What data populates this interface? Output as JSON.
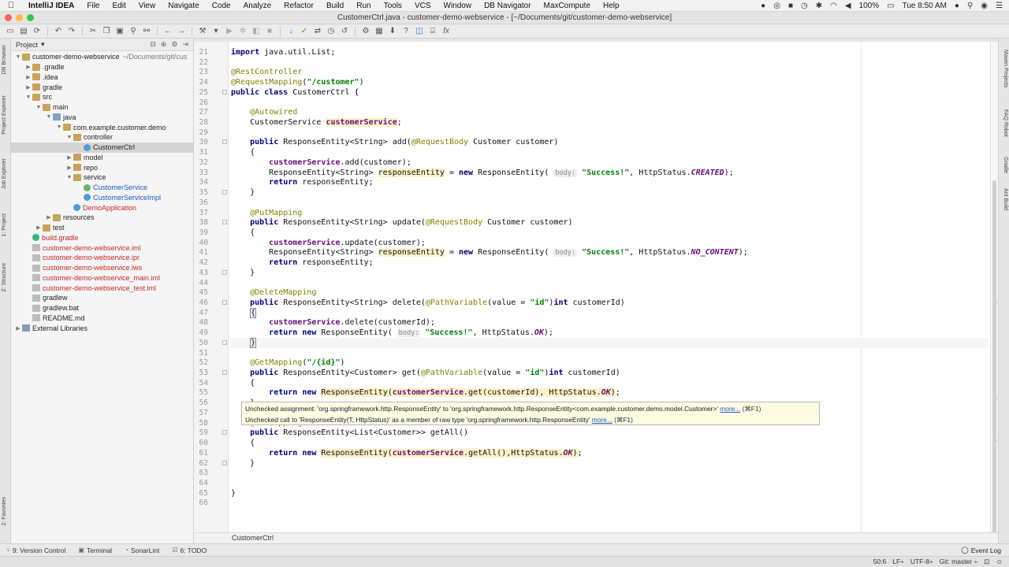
{
  "menubar": {
    "app_name": "IntelliJ IDEA",
    "items": [
      "File",
      "Edit",
      "View",
      "Navigate",
      "Code",
      "Analyze",
      "Refactor",
      "Build",
      "Run",
      "Tools",
      "VCS",
      "Window",
      "DB Navigator",
      "MaxCompute",
      "Help"
    ],
    "battery": "100%",
    "clock": "Tue 8:50 AM"
  },
  "window": {
    "title": "CustomerCtrl.java - customer-demo-webservice - [~/Documents/git/customer-demo-webservice]"
  },
  "side_tabs": {
    "left": [
      "DB Browser",
      "Project Explorer",
      "Job Explorer",
      "1: Project",
      "Z: Structure",
      "2: Favorites"
    ],
    "right": [
      "Maven Projects",
      "FAQ Robot",
      "Gradle",
      "Ant Build"
    ]
  },
  "project": {
    "header": "Project",
    "tree": [
      {
        "label": "customer-demo-webservice",
        "suffix": "~/Documents/git/cus",
        "indent": 0,
        "arrow": "▼",
        "icon": "folder",
        "color": ""
      },
      {
        "label": ".gradle",
        "suffix": "",
        "indent": 1,
        "arrow": "▶",
        "icon": "folder",
        "color": ""
      },
      {
        "label": ".idea",
        "suffix": "",
        "indent": 1,
        "arrow": "▶",
        "icon": "folder",
        "color": ""
      },
      {
        "label": "gradle",
        "suffix": "",
        "indent": 1,
        "arrow": "▶",
        "icon": "folder",
        "color": ""
      },
      {
        "label": "src",
        "suffix": "",
        "indent": 1,
        "arrow": "▼",
        "icon": "folder",
        "color": ""
      },
      {
        "label": "main",
        "suffix": "",
        "indent": 2,
        "arrow": "▼",
        "icon": "folder",
        "color": ""
      },
      {
        "label": "java",
        "suffix": "",
        "indent": 3,
        "arrow": "▼",
        "icon": "srcfolder",
        "color": ""
      },
      {
        "label": "com.example.customer.demo",
        "suffix": "",
        "indent": 4,
        "arrow": "▼",
        "icon": "folder",
        "color": ""
      },
      {
        "label": "controller",
        "suffix": "",
        "indent": 5,
        "arrow": "▼",
        "icon": "folder",
        "color": ""
      },
      {
        "label": "CustomerCtrl",
        "suffix": "",
        "indent": 6,
        "arrow": "",
        "icon": "cls",
        "color": "",
        "selected": true
      },
      {
        "label": "model",
        "suffix": "",
        "indent": 5,
        "arrow": "▶",
        "icon": "folder",
        "color": ""
      },
      {
        "label": "repo",
        "suffix": "",
        "indent": 5,
        "arrow": "▶",
        "icon": "folder",
        "color": ""
      },
      {
        "label": "service",
        "suffix": "",
        "indent": 5,
        "arrow": "▼",
        "icon": "folder",
        "color": ""
      },
      {
        "label": "CustomerService",
        "suffix": "",
        "indent": 6,
        "arrow": "",
        "icon": "intf",
        "color": "blue"
      },
      {
        "label": "CustomerServiceImpl",
        "suffix": "",
        "indent": 6,
        "arrow": "",
        "icon": "cls",
        "color": "blue"
      },
      {
        "label": "DemoApplication",
        "suffix": "",
        "indent": 5,
        "arrow": "",
        "icon": "cls",
        "color": "red"
      },
      {
        "label": "resources",
        "suffix": "",
        "indent": 3,
        "arrow": "▶",
        "icon": "folder",
        "color": ""
      },
      {
        "label": "test",
        "suffix": "",
        "indent": 2,
        "arrow": "▶",
        "icon": "folder",
        "color": ""
      },
      {
        "label": "build.gradle",
        "suffix": "",
        "indent": 1,
        "arrow": "",
        "icon": "gradle",
        "color": "red"
      },
      {
        "label": "customer-demo-webservice.iml",
        "suffix": "",
        "indent": 1,
        "arrow": "",
        "icon": "file",
        "color": "red"
      },
      {
        "label": "customer-demo-webservice.ipr",
        "suffix": "",
        "indent": 1,
        "arrow": "",
        "icon": "file",
        "color": "red"
      },
      {
        "label": "customer-demo-webservice.iws",
        "suffix": "",
        "indent": 1,
        "arrow": "",
        "icon": "file",
        "color": "red"
      },
      {
        "label": "customer-demo-webservice_main.iml",
        "suffix": "",
        "indent": 1,
        "arrow": "",
        "icon": "file",
        "color": "red"
      },
      {
        "label": "customer-demo-webservice_test.iml",
        "suffix": "",
        "indent": 1,
        "arrow": "",
        "icon": "file",
        "color": "red"
      },
      {
        "label": "gradlew",
        "suffix": "",
        "indent": 1,
        "arrow": "",
        "icon": "file",
        "color": ""
      },
      {
        "label": "gradlew.bat",
        "suffix": "",
        "indent": 1,
        "arrow": "",
        "icon": "file",
        "color": ""
      },
      {
        "label": "README.md",
        "suffix": "",
        "indent": 1,
        "arrow": "",
        "icon": "file",
        "color": ""
      },
      {
        "label": "External Libraries",
        "suffix": "",
        "indent": 0,
        "arrow": "▶",
        "icon": "lib",
        "color": ""
      }
    ]
  },
  "editor": {
    "first_line": 21,
    "lines": [
      "<span class=\"kw\">import</span> java.util.List;",
      "",
      "<span class=\"ann\">@RestController</span>",
      "<span class=\"ann\">@RequestMapping</span>(<span class=\"str\">\"/customer\"</span>)",
      "<span class=\"kw\">public class</span> CustomerCtrl {",
      "",
      "    <span class=\"ann\">@Autowired</span>",
      "    CustomerService <span class=\"fld hl\">customerService</span>;",
      "",
      "    <span class=\"kw\">public</span> ResponseEntity&lt;String&gt; add(<span class=\"ann\">@RequestBody</span> Customer customer)",
      "    {",
      "        <span class=\"fld\">customerService</span>.add(customer);",
      "        ResponseEntity&lt;String&gt; <span class=\"hl\">responseEntity</span> = <span class=\"kw\">new</span> ResponseEntity( <span class=\"hint\">body:</span> <span class=\"str\">\"Success!\"</span>, HttpStatus.<span class=\"cnst\">CREATED</span>);",
      "        <span class=\"kw\">return</span> responseEntity;",
      "    }",
      "",
      "    <span class=\"ann\">@PutMapping</span>",
      "    <span class=\"kw\">public</span> ResponseEntity&lt;String&gt; update(<span class=\"ann\">@RequestBody</span> Customer customer)",
      "    {",
      "        <span class=\"fld\">customerService</span>.update(customer);",
      "        ResponseEntity&lt;String&gt; <span class=\"hl\">responseEntity</span> = <span class=\"kw\">new</span> ResponseEntity( <span class=\"hint\">body:</span> <span class=\"str\">\"Success!\"</span>, HttpStatus.<span class=\"cnst\">NO_CONTENT</span>);",
      "        <span class=\"kw\">return</span> responseEntity;",
      "    }",
      "",
      "    <span class=\"ann\">@DeleteMapping</span>",
      "    <span class=\"kw\">public</span> ResponseEntity&lt;String&gt; delete(<span class=\"ann\">@PathVariable</span>(value = <span class=\"str\">\"id\"</span>)<span class=\"kw\">int</span> customerId)",
      "    <span class=\"brace-m\">{</span>",
      "        <span class=\"fld\">customerService</span>.delete(customerId);",
      "        <span class=\"kw\">return new</span> ResponseEntity( <span class=\"hint\">body:</span> <span class=\"str\">\"Success!\"</span>, HttpStatus.<span class=\"cnst\">OK</span>);",
      "    <span class=\"brace-m\">}</span>",
      "",
      "    <span class=\"ann\">@GetMapping</span>(<span class=\"str\">\"/{id}\"</span>)",
      "    <span class=\"kw\">public</span> ResponseEntity&lt;Customer&gt; get(<span class=\"ann\">@PathVariable</span>(value = <span class=\"str\">\"id\"</span>)<span class=\"kw\">int</span> customerId)",
      "    {",
      "        <span class=\"kw\">return new</span> <span class=\"hl\">ResponseEntity(<span class=\"fld\">customerService</span>.get(customerId), HttpStatus.<span class=\"cnst\">OK</span>)</span>;",
      "    }",
      "",
      "    <span class=\"ann\">@GetMapping</span>",
      "    <span class=\"kw\">public</span> ResponseEntity&lt;List&lt;Customer&gt;&gt; getAll()",
      "    {",
      "        <span class=\"kw\">return new</span> <span class=\"hl\">ResponseEntity(<span class=\"fld\">customerService</span>.getAll(),HttpStatus.<span class=\"cnst\">OK</span>)</span>;",
      "    }",
      "",
      "",
      "}",
      ""
    ],
    "current_line": 50
  },
  "tooltip": {
    "line1": "Unchecked assignment: 'org.springframework.http.ResponseEntity' to 'org.springframework.http.ResponseEntity<com.example.customer.demo.model.Customer>'",
    "line1_link": "more...",
    "line1_shortcut": "(⌘F1)",
    "line2": "Unchecked call to 'ResponseEntity(T, HttpStatus)' as a member of raw type 'org.springframework.http.ResponseEntity'",
    "line2_link": "more...",
    "line2_shortcut": "(⌘F1)"
  },
  "breadcrumb": {
    "text": "CustomerCtrl"
  },
  "bottombar": {
    "tabs": [
      "9: Version Control",
      "Terminal",
      "SonarLint",
      "6: TODO"
    ],
    "event_log": "Event Log"
  },
  "statusbar": {
    "position": "50:6",
    "line_sep": "LF÷",
    "encoding": "UTF-8÷",
    "git": "Git: master ÷"
  }
}
